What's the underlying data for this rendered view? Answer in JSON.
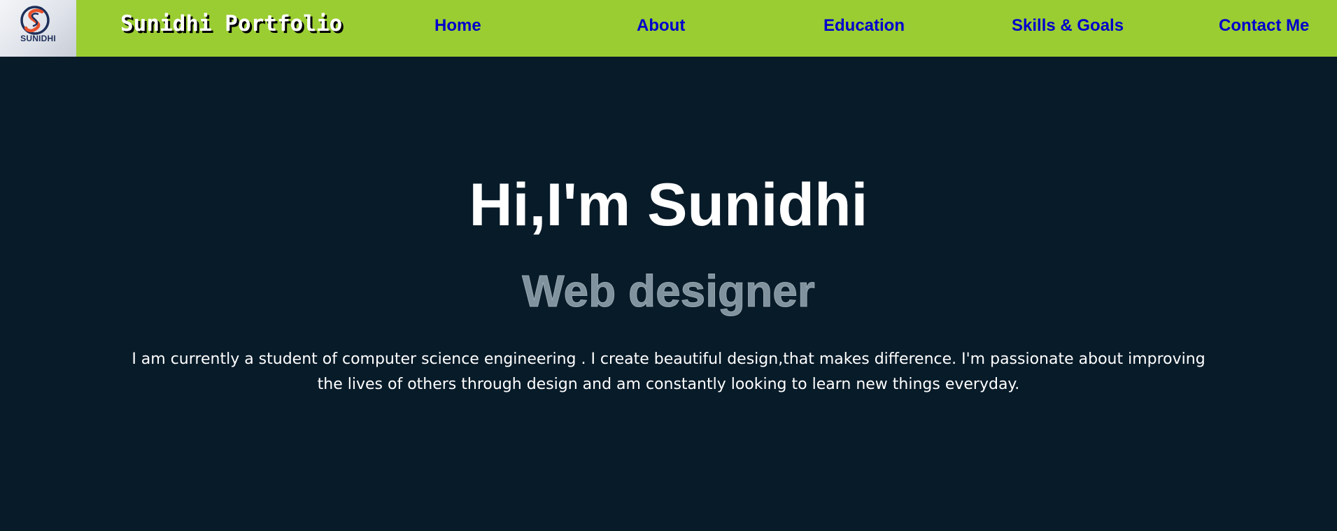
{
  "logo": {
    "text": "SUNIDHI",
    "icon": "sunidhi-logo-mark"
  },
  "navbar": {
    "brand": "Sunidhi Portfolio",
    "links": [
      {
        "label": "Home"
      },
      {
        "label": "About"
      },
      {
        "label": "Education"
      },
      {
        "label": "Skills & Goals"
      },
      {
        "label": "Contact Me"
      }
    ]
  },
  "hero": {
    "title": "Hi,I'm Sunidhi",
    "subtitle": "Web designer",
    "description": "I am currently a student of computer science engineering . I create beautiful design,that makes difference. I'm passionate about improving the lives of others through design and am constantly looking to learn new things everyday."
  },
  "colors": {
    "navbar_bg": "#9acd32",
    "page_bg": "#081b29",
    "nav_link": "#0000cd",
    "subtitle": "#7f929d",
    "text": "#ffffff"
  }
}
